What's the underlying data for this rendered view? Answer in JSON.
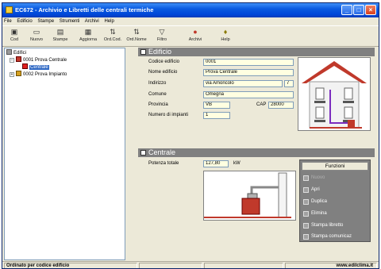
{
  "window": {
    "title": "EC672 - Archivio e Libretti delle centrali termiche",
    "controls": {
      "minimize": "_",
      "maximize": "□",
      "close": "×"
    }
  },
  "menu": [
    "File",
    "Edificio",
    "Stampe",
    "Strumenti",
    "Archivi",
    "Help"
  ],
  "toolbar": [
    {
      "label": "Cod",
      "icon": "new-building-icon"
    },
    {
      "label": "Nuovo",
      "icon": "new-document-icon"
    },
    {
      "label": "Stampe",
      "icon": "printer-icon"
    },
    {
      "label": "Aggiorna",
      "icon": "refresh-icon"
    },
    {
      "label": "Ord.Cod.",
      "icon": "sort-code-icon"
    },
    {
      "label": "Ord.Nome",
      "icon": "sort-name-icon"
    },
    {
      "label": "Filtro",
      "icon": "filter-icon"
    },
    {
      "label": "Archivi",
      "icon": "archive-icon"
    },
    {
      "label": "Help",
      "icon": "help-icon"
    }
  ],
  "tree": {
    "root": "Edifici",
    "items": [
      {
        "label": "0001 Prova Centrale",
        "expanded": true
      },
      {
        "label": "Centrale",
        "selected": true
      },
      {
        "label": "0002 Prova Impianto",
        "expanded": false
      }
    ]
  },
  "edificio": {
    "header": "Edificio",
    "fields": {
      "codice_label": "Codice edificio",
      "codice": "0001",
      "nome_label": "Nome edificio",
      "nome": "Prova Centrale",
      "indirizzo_label": "Indirizzo",
      "indirizzo": "via Amoncolo",
      "civico": "7",
      "comune_label": "Comune",
      "comune": "Omegna",
      "provincia_label": "Provincia",
      "provincia": "VB",
      "cap_label": "CAP",
      "cap": "28000",
      "impianti_label": "Numero di impianti",
      "impianti": "1"
    }
  },
  "centrale": {
    "header": "Centrale",
    "potenza_label": "Potenza totale",
    "potenza": "127,80",
    "potenza_unit": "kW"
  },
  "funzioni": {
    "title": "Funzioni",
    "buttons": [
      {
        "label": "Nuovo",
        "enabled": false
      },
      {
        "label": "Apri",
        "enabled": true
      },
      {
        "label": "Duplica",
        "enabled": true
      },
      {
        "label": "Elimina",
        "enabled": true
      },
      {
        "label": "Stampa libretto",
        "enabled": true
      },
      {
        "label": "Stampa comunicaz",
        "enabled": true
      }
    ]
  },
  "status": {
    "left": "Ordinato per codice edificio",
    "right": "www.edilclima.it"
  },
  "colors": {
    "title_blue": "#0a5ae0",
    "section_gray": "#808080",
    "field_yellow": "#ffffe1",
    "building_red": "#c0392b"
  }
}
